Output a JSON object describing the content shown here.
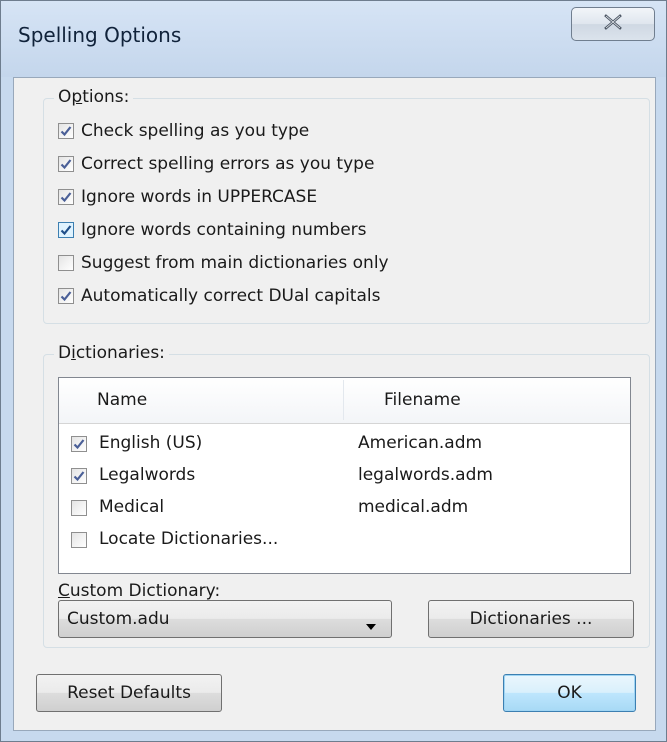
{
  "window": {
    "title": "Spelling Options"
  },
  "options_group": {
    "legend_underlined": "p",
    "legend_pre": "O",
    "legend_post": "tions:",
    "items": [
      {
        "label": "Check spelling as you type",
        "checked": true
      },
      {
        "label": "Correct spelling errors as you type",
        "checked": true
      },
      {
        "label": "Ignore words in UPPERCASE",
        "checked": true
      },
      {
        "label": "Ignore words containing numbers",
        "checked": true
      },
      {
        "label": "Suggest from main dictionaries only",
        "checked": false
      },
      {
        "label": "Automatically correct DUal capitals",
        "checked": true
      }
    ]
  },
  "dictionaries_group": {
    "legend_pre": "D",
    "legend_underlined": "i",
    "legend_post": "ctionaries:",
    "columns": {
      "name": "Name",
      "filename": "Filename"
    },
    "rows": [
      {
        "name": "English (US)",
        "filename": "American.adm",
        "checked": true
      },
      {
        "name": "Legalwords",
        "filename": "legalwords.adm",
        "checked": true
      },
      {
        "name": "Medical",
        "filename": "medical.adm",
        "checked": false
      },
      {
        "name": "Locate Dictionaries...",
        "filename": "",
        "checked": false
      }
    ],
    "custom_label_underlined": "C",
    "custom_label_post": "ustom Dictionary:",
    "custom_value": "Custom.adu",
    "dictionaries_button": "Dictionaries ..."
  },
  "footer": {
    "reset_button": "Reset Defaults",
    "ok_button": "OK"
  },
  "colors": {
    "check": "#4a5f97",
    "window_frame": "#c7d9ee",
    "default_button": "#3c7fb1"
  }
}
